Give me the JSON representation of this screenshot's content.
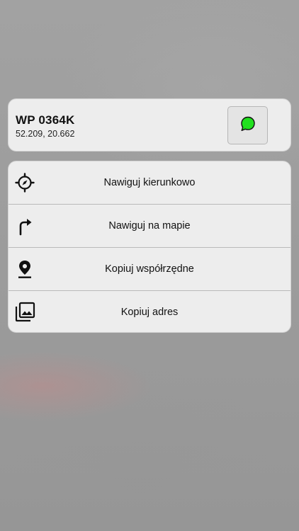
{
  "header": {
    "title": "WP 0364K",
    "coordinates": "52.209, 20.662",
    "message_icon": "chat-bubble-icon",
    "message_icon_color": "#22e01f"
  },
  "menu": {
    "items": [
      {
        "label": "Nawiguj kierunkowo",
        "icon": "crosshair-compass-icon"
      },
      {
        "label": "Nawiguj na mapie",
        "icon": "turn-right-arrow-icon"
      },
      {
        "label": "Kopiuj współrzędne",
        "icon": "location-pin-icon"
      },
      {
        "label": "Kopiuj adres",
        "icon": "photo-library-icon"
      }
    ]
  }
}
